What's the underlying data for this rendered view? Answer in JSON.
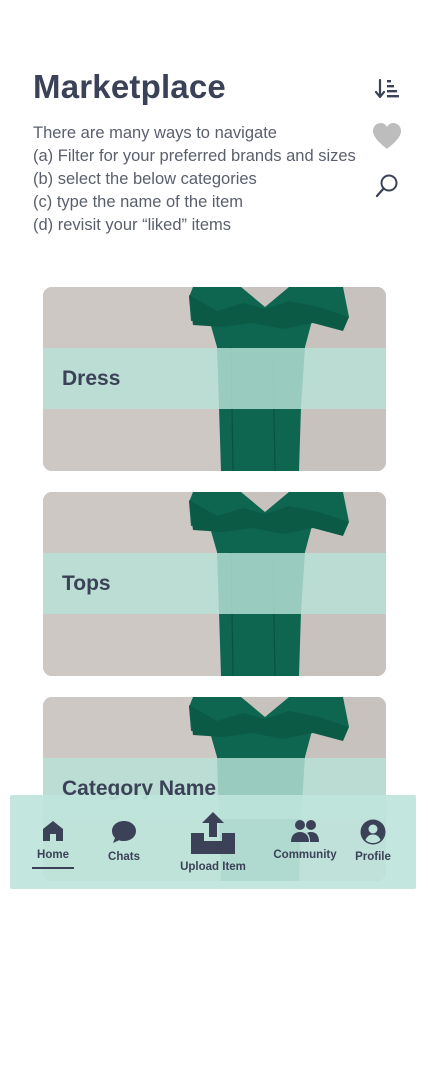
{
  "header": {
    "title": "Marketplace",
    "description_lines": [
      "There are many ways to navigate",
      "(a) Filter for your preferred brands and sizes",
      "(b) select the below categories",
      "(c) type the name of the item",
      "(d) revisit your “liked” items"
    ]
  },
  "toolbar": {
    "sort_icon": "sort-icon",
    "liked_icon": "heart-icon",
    "search_icon": "search-icon"
  },
  "categories": [
    {
      "label": "Dress"
    },
    {
      "label": "Tops"
    },
    {
      "label": "Category Name"
    }
  ],
  "bottom_nav": {
    "items": [
      {
        "label": "Home",
        "icon": "home-icon",
        "active": true
      },
      {
        "label": "Chats",
        "icon": "chat-bubble-icon",
        "active": false
      },
      {
        "label": "Upload Item",
        "icon": "upload-icon",
        "active": false
      },
      {
        "label": "Community",
        "icon": "people-icon",
        "active": false
      },
      {
        "label": "Profile",
        "icon": "profile-icon",
        "active": false
      }
    ]
  },
  "colors": {
    "text_primary": "#3b4257",
    "nav_background": "#bee4db",
    "category_band": "#b8e2d8",
    "dress_green": "#0e6650"
  }
}
